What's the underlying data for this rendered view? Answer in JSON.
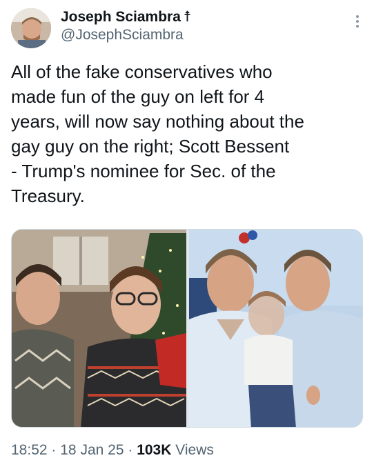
{
  "author": {
    "display_name": "Joseph Sciambra",
    "name_badge": "☨",
    "handle": "@JosephSciambra"
  },
  "tweet": {
    "lines": [
      "All of the fake conservatives who",
      "made fun of the guy on left for 4",
      "years, will now say nothing about the",
      "gay guy on the right; Scott Bessent",
      "- Trump's nominee for Sec. of the",
      "Treasury."
    ]
  },
  "media": {
    "count": 2,
    "photos": [
      {
        "icon": "photo-two-men-christmas-tree"
      },
      {
        "icon": "photo-two-men-with-child"
      }
    ]
  },
  "meta": {
    "time": "18:52",
    "separator": "·",
    "date": "18 Jan 25",
    "views_count": "103K",
    "views_label": "Views"
  },
  "colors": {
    "text_primary": "#0f1419",
    "text_secondary": "#536471",
    "border": "#cfd9de"
  }
}
